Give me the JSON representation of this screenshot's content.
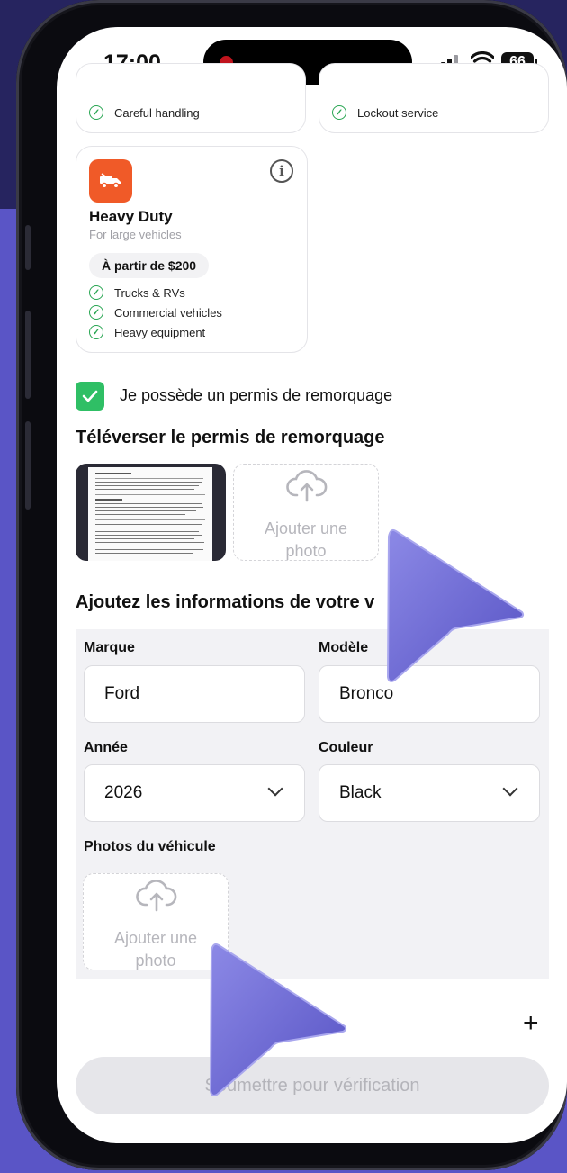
{
  "status_bar": {
    "time": "17:00",
    "battery": "66"
  },
  "top_cards": {
    "left_item": "Careful handling",
    "right_item": "Lockout service"
  },
  "heavy_duty": {
    "title": "Heavy Duty",
    "subtitle": "For large vehicles",
    "price": "À partir de $200",
    "features": [
      "Trucks & RVs",
      "Commercial vehicles",
      "Heavy equipment"
    ]
  },
  "permit": {
    "checkbox_label": "Je possède un permis de remorquage",
    "checked": true,
    "upload_title": "Téléverser le permis de remorquage",
    "add_photo_line1": "Ajouter une",
    "add_photo_line2": "photo"
  },
  "vehicle": {
    "section_title": "Ajoutez les informations de votre v",
    "brand_label": "Marque",
    "brand_value": "Ford",
    "model_label": "Modèle",
    "model_value": "Bronco",
    "year_label": "Année",
    "year_value": "2026",
    "color_label": "Couleur",
    "color_value": "Black",
    "photos_label": "Photos du véhicule",
    "add_photo_line1": "Ajouter une",
    "add_photo_line2": "photo"
  },
  "submit_label": "Soumettre pour vérification",
  "colors": {
    "accent_green": "#2fbf65",
    "badge_orange": "#f05a28",
    "cursor": "#6b68d6"
  }
}
